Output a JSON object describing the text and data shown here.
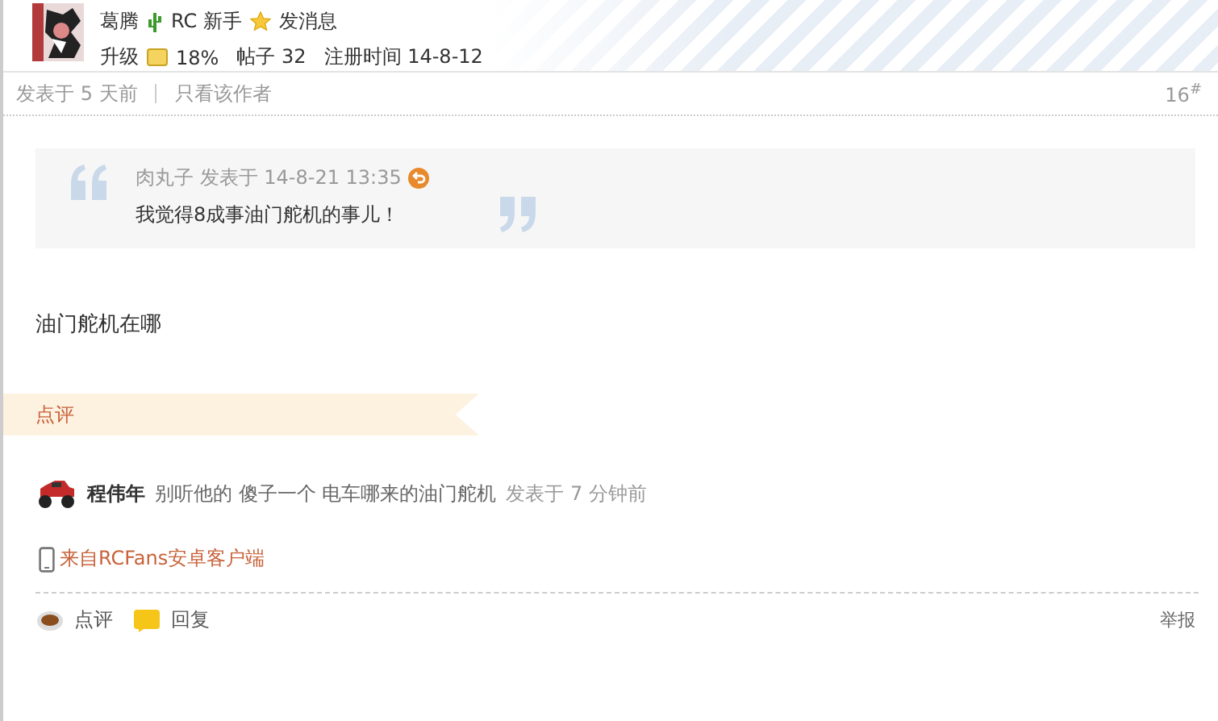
{
  "author": {
    "name": "葛腾",
    "group": "RC 新手",
    "message_link": "发消息",
    "upgrade_label": "升级",
    "upgrade_percent": "18%",
    "posts": "帖子 32",
    "registered": "注册时间 14-8-12"
  },
  "post_meta": {
    "posted": "发表于 5 天前",
    "author_only": "只看该作者",
    "floor": "16",
    "floor_mark": "#"
  },
  "quote": {
    "author": "肉丸子",
    "time": "发表于 14-8-21 13:35",
    "text": "我觉得8成事油门舵机的事儿！"
  },
  "body": "油门舵机在哪",
  "comments_title": "点评",
  "comments": [
    {
      "user": "程伟年",
      "text": "别听他的 傻子一个 电车哪来的油门舵机",
      "time": "发表于 7 分钟前"
    }
  ],
  "client_link": "来自RCFans安卓客户端",
  "actions": [
    {
      "kind": "comment",
      "label": "点评"
    },
    {
      "kind": "reply",
      "label": "回复"
    }
  ],
  "report": "举报"
}
